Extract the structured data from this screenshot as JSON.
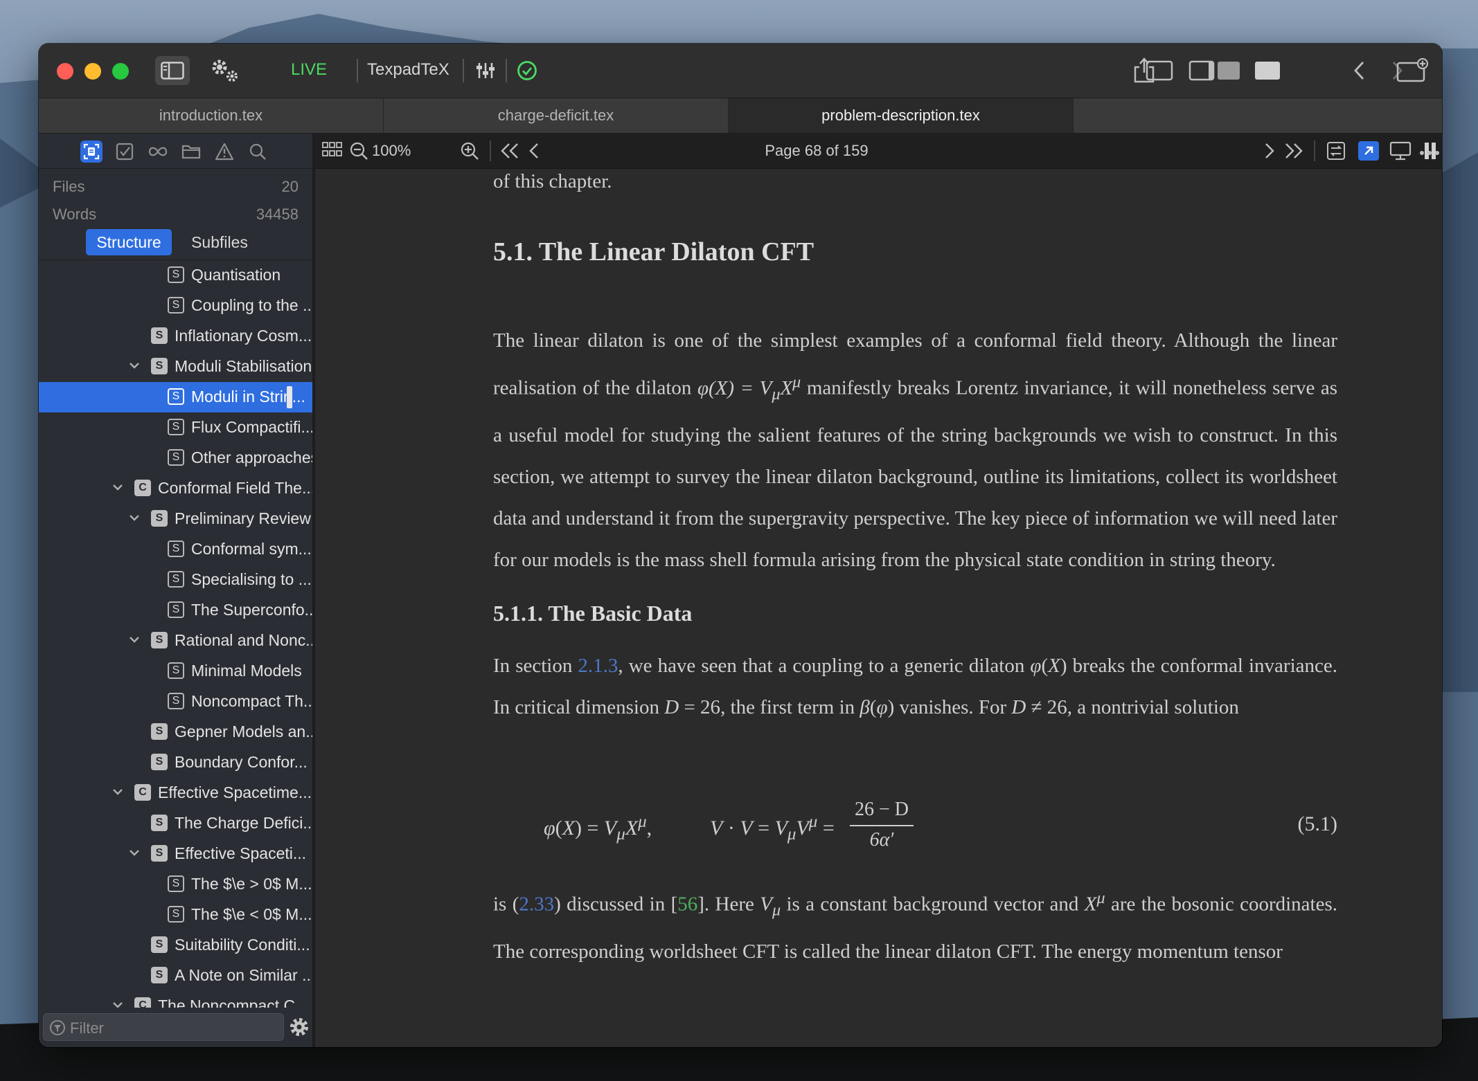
{
  "colors": {
    "accent": "#2f6ee0",
    "live": "#4cd964",
    "citation_link": "#4fae5c",
    "ref_link": "#4f76c9"
  },
  "toolbar": {
    "live_label": "LIVE",
    "engine_label": "TexpadTeX"
  },
  "tabs": [
    {
      "label": "introduction.tex"
    },
    {
      "label": "charge-deficit.tex"
    },
    {
      "label": "problem-description.tex"
    }
  ],
  "sidebar": {
    "files_label": "Files",
    "files_count": "20",
    "words_label": "Words",
    "words_count": "34458",
    "segments": [
      "Structure",
      "Subfiles"
    ],
    "filter_placeholder": "Filter",
    "tree": [
      {
        "level": 3,
        "type": "S",
        "label": "Quantisation"
      },
      {
        "level": 3,
        "type": "S",
        "label": "Coupling to the ..."
      },
      {
        "level": 2,
        "type": "S",
        "label": "Inflationary Cosm..."
      },
      {
        "level": 2,
        "type": "S",
        "label": "Moduli Stabilisation",
        "expanded": true
      },
      {
        "level": 3,
        "type": "S",
        "label": "Moduli in Strin...",
        "selected": true
      },
      {
        "level": 3,
        "type": "S",
        "label": "Flux Compactifi..."
      },
      {
        "level": 3,
        "type": "S",
        "label": "Other approaches"
      },
      {
        "level": 1,
        "type": "C",
        "label": "Conformal Field The...",
        "expanded": true
      },
      {
        "level": 2,
        "type": "S",
        "label": "Preliminary Review",
        "expanded": true
      },
      {
        "level": 3,
        "type": "S",
        "label": "Conformal sym..."
      },
      {
        "level": 3,
        "type": "S",
        "label": "Specialising to ..."
      },
      {
        "level": 3,
        "type": "S",
        "label": "The Superconfo..."
      },
      {
        "level": 2,
        "type": "S",
        "label": "Rational and Nonc...",
        "expanded": true
      },
      {
        "level": 3,
        "type": "S",
        "label": "Minimal Models"
      },
      {
        "level": 3,
        "type": "S",
        "label": "Noncompact Th..."
      },
      {
        "level": 2,
        "type": "S",
        "label": "Gepner Models an..."
      },
      {
        "level": 2,
        "type": "S",
        "label": "Boundary Confor..."
      },
      {
        "level": 1,
        "type": "C",
        "label": "Effective Spacetime...",
        "expanded": true
      },
      {
        "level": 2,
        "type": "S",
        "label": "The Charge Defici..."
      },
      {
        "level": 2,
        "type": "S",
        "label": "Effective Spaceti...",
        "expanded": true
      },
      {
        "level": 3,
        "type": "S",
        "label": "The $\\e > 0$ M..."
      },
      {
        "level": 3,
        "type": "S",
        "label": "The $\\e < 0$ M..."
      },
      {
        "level": 2,
        "type": "S",
        "label": "Suitability Conditi..."
      },
      {
        "level": 2,
        "type": "S",
        "label": "A Note on Similar ..."
      },
      {
        "level": 1,
        "type": "C",
        "label": "The Noncompact C...",
        "expanded": true
      }
    ]
  },
  "viewer": {
    "zoom": "100%",
    "page_indicator": "Page 68 of 159"
  },
  "document": {
    "top_fragment": "of this chapter.",
    "section_title": "5.1.  The Linear Dilaton CFT",
    "para1_a": "The linear dilaton is one of the simplest examples of a conformal field theory.  Although the linear realisation of the dilaton ",
    "para1_math": "φ(X) = V",
    "para1_b": " manifestly breaks Lorentz invariance, it will nonetheless serve as a useful model for studying the salient features of the string backgrounds we wish to construct.  In this section, we attempt to survey the linear dilaton background, outline its limitations, collect its worldsheet data and understand it from the supergravity perspective. The key piece of information we will need later for our models is the mass shell formula arising from the physical state condition in string theory.",
    "subsection_title": "5.1.1.  The Basic Data",
    "para2_a": "In section ",
    "para2_ref": "2.1.3",
    "para2_b": ", we have seen that a coupling to a generic dilaton ",
    "para2_c": " breaks the conformal invariance.  In critical dimension ",
    "para2_d": ", the first term in ",
    "para2_e": " vanishes.  For ",
    "para2_f": ", a nontrivial solution",
    "eq_number": "(5.1)",
    "eq_frac_num": "26 − D",
    "eq_frac_den": "6α′",
    "para3_a": "is (",
    "para3_ref": "2.33",
    "para3_b": ") discussed in [",
    "para3_cite": "56",
    "para3_c": "].  Here ",
    "para3_d": " is a constant background vector and ",
    "para3_e": " are the bosonic coordinates. The corresponding worldsheet CFT is called the linear dilaton CFT. The energy momentum tensor"
  }
}
